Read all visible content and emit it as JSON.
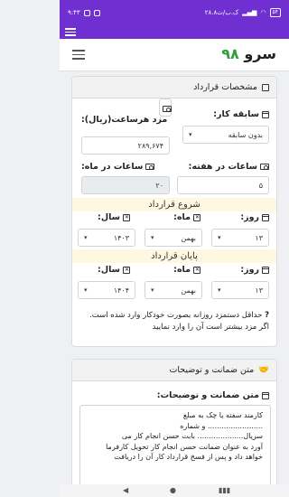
{
  "status": {
    "time": "۹:۴۳",
    "speed": "۲۸.۸ک.ب/ث",
    "battery": "۵۴"
  },
  "app": {
    "logo_text": "سرو",
    "logo_number": "۹۸"
  },
  "contract": {
    "header": "مشخصات قرارداد",
    "experience_label": "سابقه کار:",
    "experience_value": "بدون سابقه",
    "wage_label": "مزد هرساعت(ریال):",
    "wage_value": "۲۸۹,۶۷۴",
    "weekly_hours_label": "ساعات در هفته:",
    "weekly_hours_value": "۵",
    "monthly_hours_label": "ساعات در ماه:",
    "monthly_hours_value": "۲۰",
    "start_title": "شروع قرارداد",
    "end_title": "پایان قرارداد",
    "day_label": "روز:",
    "month_label": "ماه:",
    "year_label": "سال:",
    "start_day": "۱۳",
    "start_month": "بهمن",
    "start_year": "۱۴۰۳",
    "end_day": "۱۳",
    "end_month": "بهمن",
    "end_year": "۱۴۰۴",
    "note_line1": "حداقل دستمزد روزانه بصورت خودکار وارد شده است.",
    "note_line2": "اگر مزد بیشتر است آن را وارد نمایید"
  },
  "guarantee": {
    "header": "متن ضمانت و توضیحات",
    "label": "متن ضمانت و توضیحات:",
    "lines": [
      "کارمند سفته یا چک به مبلغ",
      "........................ و شماره",
      "سریال.................... بابت حسن انجام کار می",
      "آورد به عنوان ضمانت حسن انجام کار تحویل کارفرما",
      "خواهد داد و پس از فسخ قرارداد کار آن را دریافت"
    ]
  }
}
